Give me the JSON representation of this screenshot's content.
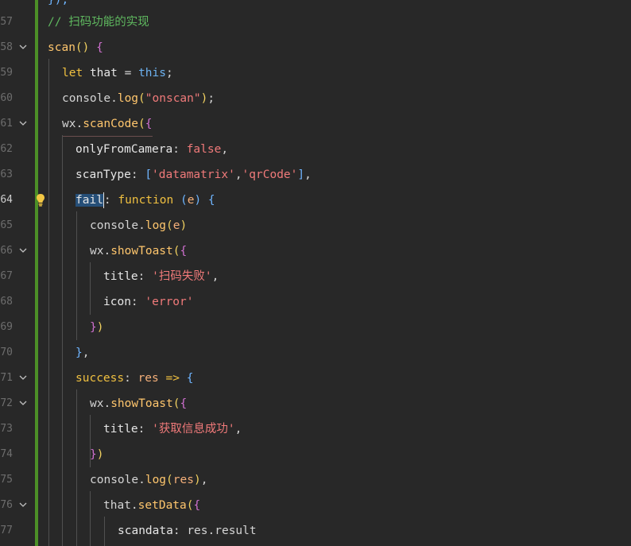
{
  "lines": [
    {
      "num": "",
      "text": "});"
    },
    {
      "num": "57",
      "text": "// 扫码功能的实现"
    },
    {
      "num": "58",
      "text": "scan() {"
    },
    {
      "num": "59",
      "text": "let that = this;"
    },
    {
      "num": "60",
      "text": "console.log(\"onscan\");"
    },
    {
      "num": "61",
      "text": "wx.scanCode({"
    },
    {
      "num": "62",
      "text": "onlyFromCamera: false,"
    },
    {
      "num": "63",
      "text": "scanType: ['datamatrix','qrCode'],"
    },
    {
      "num": "64",
      "text": "fail: function (e) {"
    },
    {
      "num": "65",
      "text": "console.log(e)"
    },
    {
      "num": "66",
      "text": "wx.showToast({"
    },
    {
      "num": "67",
      "text": "title: '扫码失败',"
    },
    {
      "num": "68",
      "text": "icon: 'error'"
    },
    {
      "num": "69",
      "text": "})"
    },
    {
      "num": "70",
      "text": "},"
    },
    {
      "num": "71",
      "text": "success: res => {"
    },
    {
      "num": "72",
      "text": "wx.showToast({"
    },
    {
      "num": "73",
      "text": "title: '获取信息成功',"
    },
    {
      "num": "74",
      "text": "})"
    },
    {
      "num": "75",
      "text": "console.log(res),"
    },
    {
      "num": "76",
      "text": "that.setData({"
    },
    {
      "num": "77",
      "text": "scandata: res.result"
    }
  ],
  "tokens": {
    "l57": {
      "comment": "// 扫码功能的实现"
    },
    "l58": {
      "name": "scan",
      "parens": "()",
      "brace": "{"
    },
    "l59": {
      "kw": "let",
      "var": "that",
      "eq": "=",
      "this": "this",
      "semi": ";"
    },
    "l60": {
      "obj": "console",
      "dot": ".",
      "fn": "log",
      "open": "(",
      "str": "\"onscan\"",
      "close": ")",
      "semi": ";"
    },
    "l61": {
      "obj": "wx",
      "dot": ".",
      "fn": "scanCode",
      "open": "(",
      "brace": "{"
    },
    "l62": {
      "prop": "onlyFromCamera",
      "colon": ":",
      "val": "false",
      "comma": ","
    },
    "l63": {
      "prop": "scanType",
      "colon": ":",
      "open": "[",
      "s1": "'datamatrix'",
      "comma1": ",",
      "s2": "'qrCode'",
      "close": "]",
      "comma": ","
    },
    "l64": {
      "sel": "fail",
      "colon": ":",
      "kw": "function",
      "open": "(",
      "param": "e",
      "close": ")",
      "brace": "{"
    },
    "l65": {
      "obj": "console",
      "dot": ".",
      "fn": "log",
      "open": "(",
      "arg": "e",
      "close": ")"
    },
    "l66": {
      "obj": "wx",
      "dot": ".",
      "fn": "showToast",
      "open": "(",
      "brace": "{"
    },
    "l67": {
      "prop": "title",
      "colon": ":",
      "str": "'扫码失败'",
      "comma": ","
    },
    "l68": {
      "prop": "icon",
      "colon": ":",
      "str": "'error'"
    },
    "l69": {
      "brace": "}",
      "close": ")"
    },
    "l70": {
      "brace": "}",
      "comma": ","
    },
    "l71": {
      "prop": "success",
      "colon": ":",
      "param": "res",
      "arrow": "=>",
      "brace": "{"
    },
    "l72": {
      "obj": "wx",
      "dot": ".",
      "fn": "showToast",
      "open": "(",
      "brace": "{"
    },
    "l73": {
      "prop": "title",
      "colon": ":",
      "str": "'获取信息成功'",
      "comma": ","
    },
    "l74": {
      "brace": "}",
      "close": ")"
    },
    "l75": {
      "obj": "console",
      "dot": ".",
      "fn": "log",
      "open": "(",
      "arg": "res",
      "close": ")",
      "comma": ","
    },
    "l76": {
      "obj": "that",
      "dot": ".",
      "fn": "setData",
      "open": "(",
      "brace": "{"
    },
    "l77": {
      "prop": "scandata",
      "colon": ":",
      "val": "res.result"
    },
    "l56": {
      "text": "});"
    }
  },
  "editor": {
    "active_line": "64",
    "selection": "fail",
    "icons": {
      "fold": "chevron-down-icon",
      "hint": "lightbulb-icon"
    },
    "colors": {
      "background": "#282828",
      "modified_bar": "#4c8f27",
      "selection": "#264f78"
    }
  }
}
